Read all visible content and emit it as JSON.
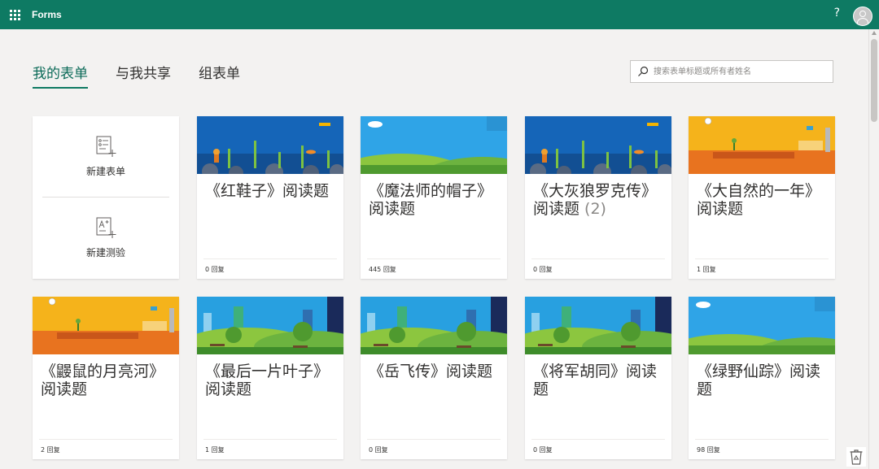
{
  "header": {
    "app_name": "Forms",
    "help_label": "?"
  },
  "tabs": [
    {
      "label": "我的表单",
      "active": true
    },
    {
      "label": "与我共享",
      "active": false
    },
    {
      "label": "组表单",
      "active": false
    }
  ],
  "search": {
    "placeholder": "搜索表单标题或所有者姓名",
    "value": ""
  },
  "create": {
    "new_form_label": "新建表单",
    "new_quiz_label": "新建测验"
  },
  "cards": [
    {
      "title": "《红鞋子》阅读题",
      "suffix": "",
      "responses": "0 回复",
      "theme": "ocean"
    },
    {
      "title": "《魔法师的帽子》阅读题",
      "suffix": "",
      "responses": "445 回复",
      "theme": "hills"
    },
    {
      "title": "《大灰狼罗克传》阅读题 ",
      "suffix": "(2)",
      "responses": "0 回复",
      "theme": "ocean"
    },
    {
      "title": "《大自然的一年》阅读题",
      "suffix": "",
      "responses": "1 回复",
      "theme": "desert"
    },
    {
      "title": "《鼹鼠的月亮河》阅读题",
      "suffix": "",
      "responses": "2 回复",
      "theme": "desert"
    },
    {
      "title": "《最后一片叶子》阅读题",
      "suffix": "",
      "responses": "1 回复",
      "theme": "city"
    },
    {
      "title": "《岳飞传》阅读题",
      "suffix": "",
      "responses": "0 回复",
      "theme": "city"
    },
    {
      "title": "《将军胡同》阅读题",
      "suffix": "",
      "responses": "0 回复",
      "theme": "city"
    },
    {
      "title": "《绿野仙踪》阅读题",
      "suffix": "",
      "responses": "98 回复",
      "theme": "hills"
    }
  ],
  "colors": {
    "brand": "#0e7a63",
    "tab_active": "#0b6a58"
  }
}
